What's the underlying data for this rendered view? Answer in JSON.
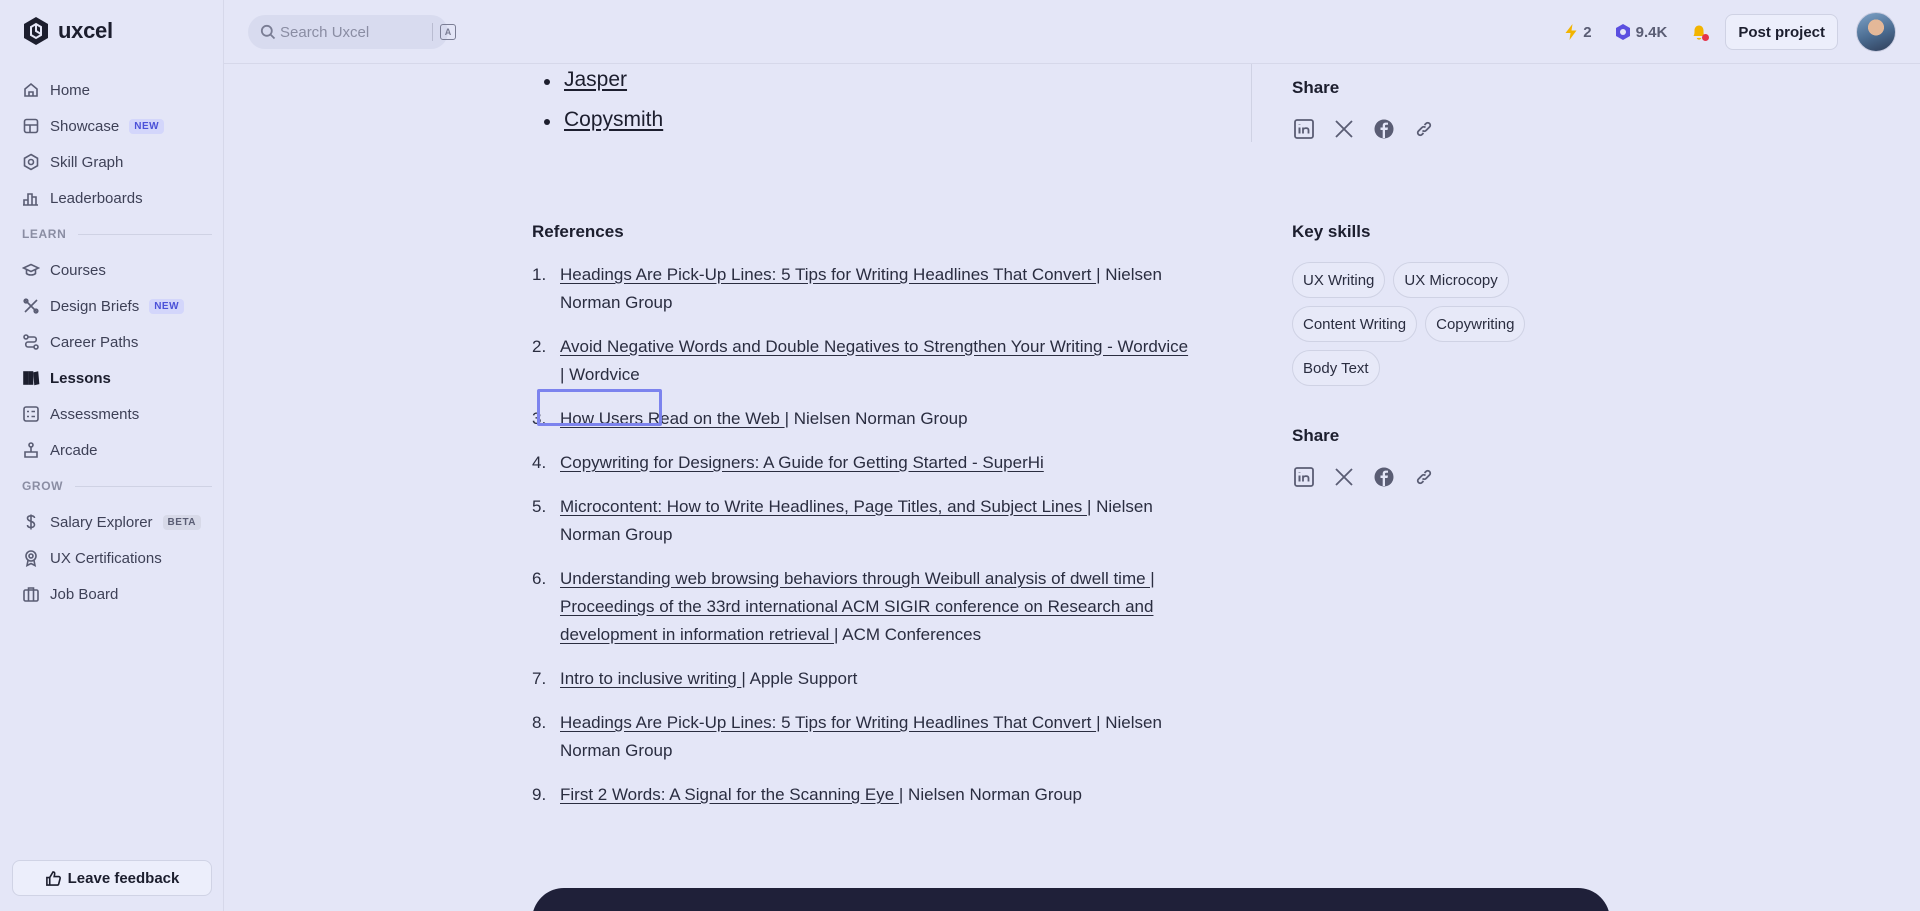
{
  "brand": {
    "name": "uxcel"
  },
  "nav": {
    "items": [
      {
        "label": "Home",
        "icon": "home-icon"
      },
      {
        "label": "Showcase",
        "icon": "showcase-icon",
        "badge": "NEW"
      },
      {
        "label": "Skill Graph",
        "icon": "skill-graph-icon"
      },
      {
        "label": "Leaderboards",
        "icon": "leaderboards-icon"
      }
    ],
    "learn_label": "LEARN",
    "learn": [
      {
        "label": "Courses",
        "icon": "courses-icon"
      },
      {
        "label": "Design Briefs",
        "icon": "design-briefs-icon",
        "badge": "NEW"
      },
      {
        "label": "Career Paths",
        "icon": "career-paths-icon"
      },
      {
        "label": "Lessons",
        "icon": "lessons-icon",
        "active": true
      },
      {
        "label": "Assessments",
        "icon": "assessments-icon"
      },
      {
        "label": "Arcade",
        "icon": "arcade-icon"
      }
    ],
    "grow_label": "GROW",
    "grow": [
      {
        "label": "Salary Explorer",
        "icon": "salary-icon",
        "badge": "BETA"
      },
      {
        "label": "UX Certifications",
        "icon": "certifications-icon"
      },
      {
        "label": "Job Board",
        "icon": "job-board-icon"
      }
    ],
    "feedback_label": "Leave feedback"
  },
  "topbar": {
    "search_placeholder": "Search Uxcel",
    "streak": "2",
    "xp": "9.4K",
    "post_project_label": "Post project"
  },
  "content": {
    "tools": [
      "Jasper",
      "Copysmith"
    ],
    "references_title": "References",
    "references": [
      {
        "num": "1.",
        "link": "Headings Are Pick-Up Lines: 5 Tips for Writing Headlines That Convert ",
        "source": "| Nielsen Norman Group"
      },
      {
        "num": "2.",
        "link": "Avoid Negative Words and Double Negatives to Strengthen Your Writing - Wordvice ",
        "source": "| Wordvice"
      },
      {
        "num": "3.",
        "link": "How Users Read on the Web ",
        "source": "| Nielsen Norman Group"
      },
      {
        "num": "4.",
        "link": "Copywriting for Designers: A Guide for Getting Started - SuperHi",
        "source": ""
      },
      {
        "num": "5.",
        "link": "Microcontent: How to Write Headlines, Page Titles, and Subject Lines ",
        "source": "| Nielsen Norman Group"
      },
      {
        "num": "6.",
        "link": "Understanding web browsing behaviors through Weibull analysis of dwell time | Proceedings of the 33rd international ACM SIGIR conference on Research and development in information retrieval ",
        "source": "| ACM Conferences"
      },
      {
        "num": "7.",
        "link": "Intro to inclusive writing ",
        "source": "| Apple Support"
      },
      {
        "num": "8.",
        "link": "Headings Are Pick-Up Lines: 5 Tips for Writing Headlines That Convert ",
        "source": "| Nielsen Norman Group"
      },
      {
        "num": "9.",
        "link": "First 2 Words: A Signal for the Scanning Eye ",
        "source": "| Nielsen Norman Group"
      }
    ]
  },
  "aside": {
    "share_title": "Share",
    "key_skills_title": "Key skills",
    "skills": [
      "UX Writing",
      "UX Microcopy",
      "Content Writing",
      "Copywriting",
      "Body Text"
    ],
    "share_icons": [
      "linkedin-icon",
      "x-icon",
      "facebook-icon",
      "link-icon"
    ]
  },
  "colors": {
    "background": "#e4e6f7",
    "accent": "#4b51d8",
    "focus_outline": "#7c83ee",
    "cta_dark": "#1f2039",
    "streak": "#f2b400",
    "xp": "#5b4fe0"
  }
}
